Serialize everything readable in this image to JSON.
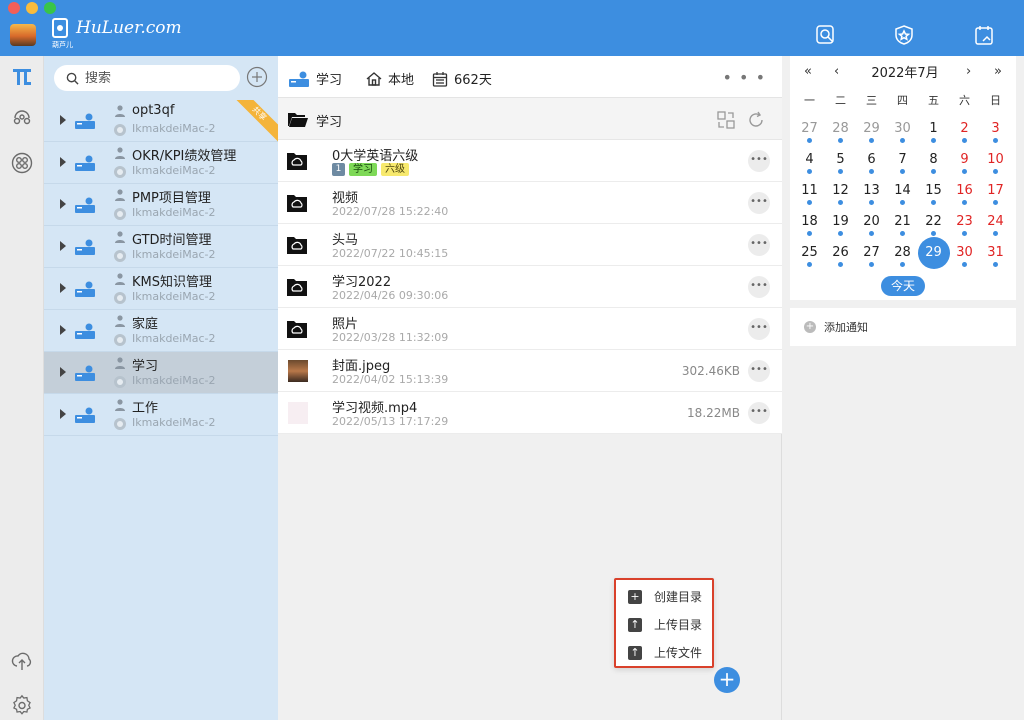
{
  "app": {
    "logo_text": "HuLuer.com",
    "logo_sub": "葫芦儿"
  },
  "search": {
    "placeholder": "搜索"
  },
  "tree": [
    {
      "name": "opt3qf",
      "host": "IkmakdeiMac-2",
      "ribbon": "共享"
    },
    {
      "name": "OKR/KPI绩效管理",
      "host": "IkmakdeiMac-2"
    },
    {
      "name": "PMP项目管理",
      "host": "IkmakdeiMac-2"
    },
    {
      "name": "GTD时间管理",
      "host": "IkmakdeiMac-2"
    },
    {
      "name": "KMS知识管理",
      "host": "IkmakdeiMac-2"
    },
    {
      "name": "家庭",
      "host": "IkmakdeiMac-2"
    },
    {
      "name": "学习",
      "host": "IkmakdeiMac-2",
      "selected": true
    },
    {
      "name": "工作",
      "host": "IkmakdeiMac-2"
    }
  ],
  "breadcrumb": {
    "drive": "学习",
    "location": "本地",
    "days": "662天",
    "more": "• • •"
  },
  "current_dir": "学习",
  "files": [
    {
      "name": "0大学英语六级",
      "type": "folder",
      "tags": [
        "1",
        "学习",
        "六级"
      ]
    },
    {
      "name": "视频",
      "type": "folder",
      "date": "2022/07/28 15:22:40"
    },
    {
      "name": "头马",
      "type": "folder",
      "date": "2022/07/22 10:45:15"
    },
    {
      "name": "学习2022",
      "type": "folder",
      "date": "2022/04/26 09:30:06"
    },
    {
      "name": "照片",
      "type": "folder",
      "date": "2022/03/28 11:32:09"
    },
    {
      "name": "封面.jpeg",
      "type": "image",
      "date": "2022/04/02 15:13:39",
      "size": "302.46KB"
    },
    {
      "name": "学习视频.mp4",
      "type": "video",
      "date": "2022/05/13 17:17:29",
      "size": "18.22MB"
    }
  ],
  "row_more": "•••",
  "popup": [
    "创建目录",
    "上传目录",
    "上传文件"
  ],
  "fab": "+",
  "calendar": {
    "title": "2022年7月",
    "nav": [
      "«",
      "‹",
      "›",
      "»"
    ],
    "weekdays": [
      "一",
      "二",
      "三",
      "四",
      "五",
      "六",
      "日"
    ],
    "weeks": [
      [
        "27",
        "28",
        "29",
        "30",
        "1",
        "2",
        "3"
      ],
      [
        "4",
        "5",
        "6",
        "7",
        "8",
        "9",
        "10"
      ],
      [
        "11",
        "12",
        "13",
        "14",
        "15",
        "16",
        "17"
      ],
      [
        "18",
        "19",
        "20",
        "21",
        "22",
        "23",
        "24"
      ],
      [
        "25",
        "26",
        "27",
        "28",
        "29",
        "30",
        "31"
      ]
    ],
    "today": "29",
    "today_button": "今天"
  },
  "notify": "添加通知",
  "colors": {
    "accent": "#3d8ee0",
    "weekend": "#e02424",
    "popup_border": "#d9412b",
    "tree_bg": "#d5e6f5"
  }
}
